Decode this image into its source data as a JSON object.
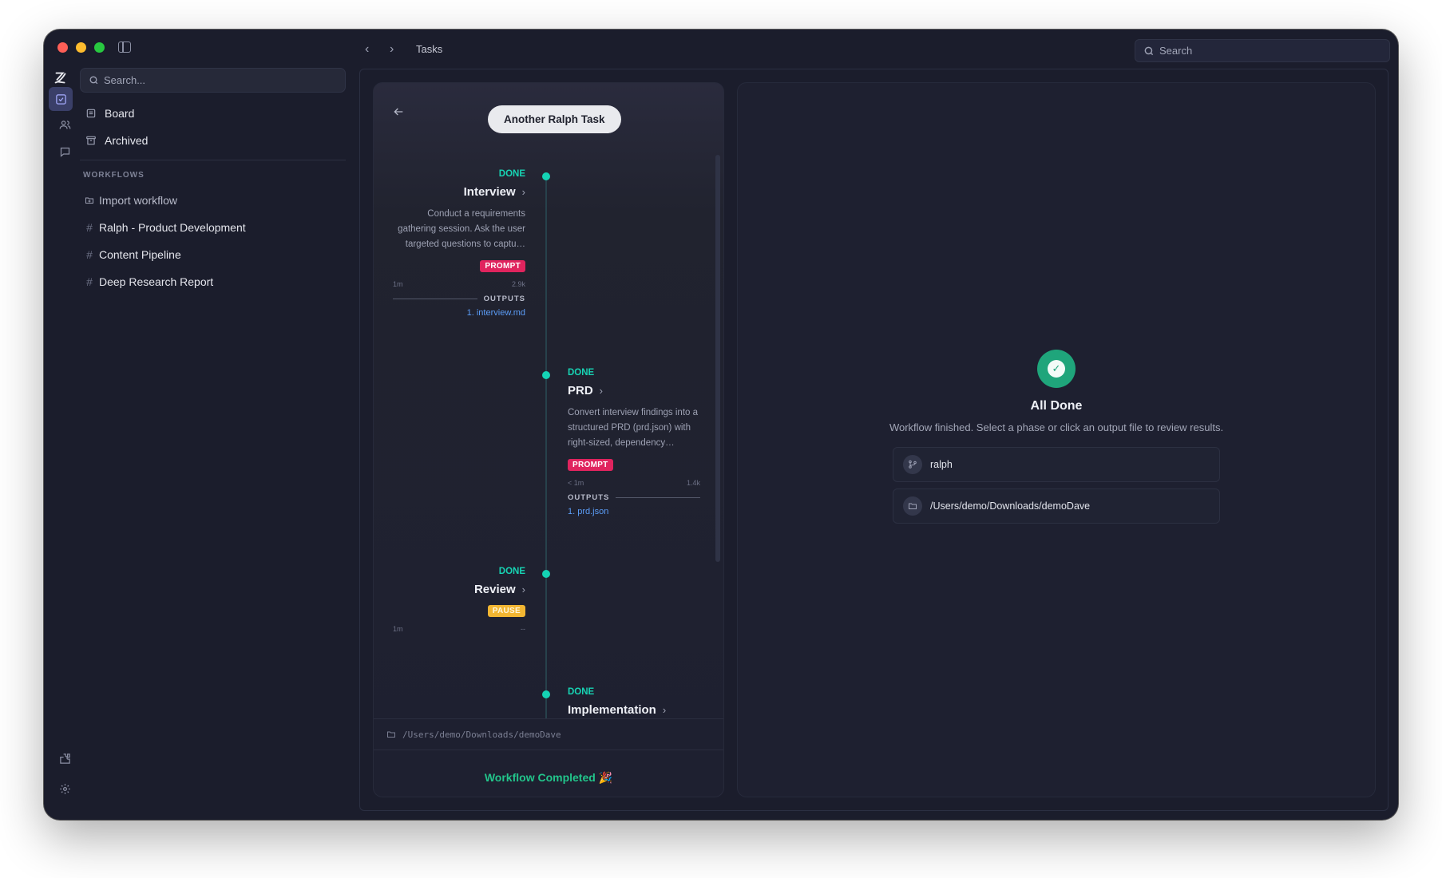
{
  "window": {
    "traffic_lights": [
      "close",
      "minimize",
      "zoom"
    ]
  },
  "topbar": {
    "breadcrumb": "Tasks",
    "search_placeholder": "Search"
  },
  "sidebar": {
    "search_placeholder": "Search...",
    "nav": [
      {
        "label": "Board",
        "icon": "board-icon"
      },
      {
        "label": "Archived",
        "icon": "archive-icon"
      }
    ],
    "section_label": "WORKFLOWS",
    "import_label": "Import workflow",
    "workflows": [
      {
        "label": "Ralph - Product Development"
      },
      {
        "label": "Content Pipeline"
      },
      {
        "label": "Deep Research Report"
      }
    ],
    "rail_icons": [
      "tasks-icon",
      "people-icon",
      "chat-icon",
      "plugin-icon",
      "settings-icon"
    ]
  },
  "task": {
    "title": "Another Ralph Task",
    "phases": [
      {
        "status": "DONE",
        "name": "Interview",
        "description": "Conduct a requirements gathering session. Ask the user targeted questions to captu…",
        "badge": "PROMPT",
        "duration": "1m",
        "tokens": "2.9k",
        "outputs_label": "OUTPUTS",
        "output_file": "1. interview.md"
      },
      {
        "status": "DONE",
        "name": "PRD",
        "description": "Convert interview findings into a structured PRD (prd.json) with right-sized, dependency…",
        "badge": "PROMPT",
        "duration": "< 1m",
        "tokens": "1.4k",
        "outputs_label": "OUTPUTS",
        "output_file": "1. prd.json"
      },
      {
        "status": "DONE",
        "name": "Review",
        "badge": "PAUSE",
        "duration": "1m",
        "tokens": "--"
      },
      {
        "status": "DONE",
        "name": "Implementation"
      }
    ],
    "path": "/Users/demo/Downloads/demoDave",
    "completed_text": "Workflow Completed 🎉"
  },
  "detail": {
    "title": "All Done",
    "subtitle": "Workflow finished. Select a phase or click an output file to review results.",
    "branch": "ralph",
    "folder": "/Users/demo/Downloads/demoDave"
  },
  "colors": {
    "accent_done": "#17d4b4",
    "prompt_badge": "#e0245e",
    "pause_badge": "#f2b632",
    "success": "#1fa57b",
    "link": "#5b9cf6"
  }
}
